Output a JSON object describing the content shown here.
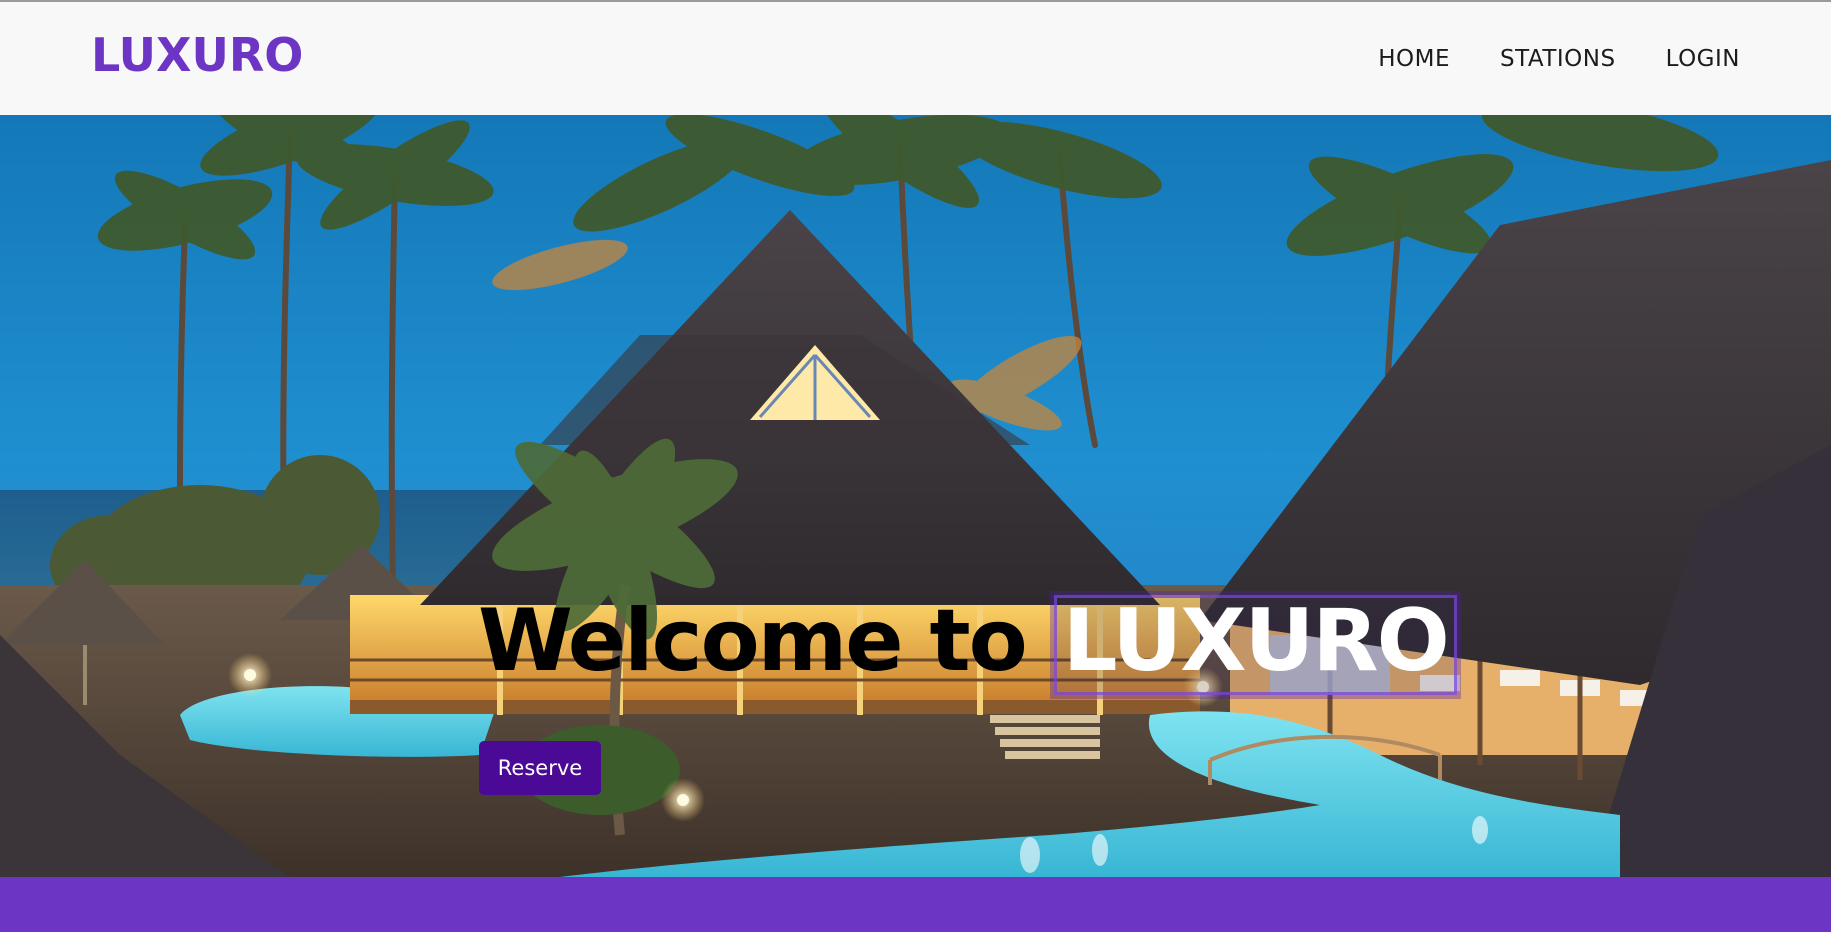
{
  "brand": {
    "name": "LUXURO"
  },
  "nav": {
    "items": [
      {
        "label": "HOME"
      },
      {
        "label": "STATIONS"
      },
      {
        "label": "LOGIN"
      }
    ]
  },
  "hero": {
    "title_prefix": "Welcome to",
    "title_highlight": "LUXURO",
    "reserve_label": "Reserve",
    "image": "tropical-resort-night-photo"
  },
  "colors": {
    "brand": "#6d35c4",
    "button": "#4b0a96",
    "navbar_bg": "#f8f8f8",
    "footer_bar": "#6d35c4"
  }
}
